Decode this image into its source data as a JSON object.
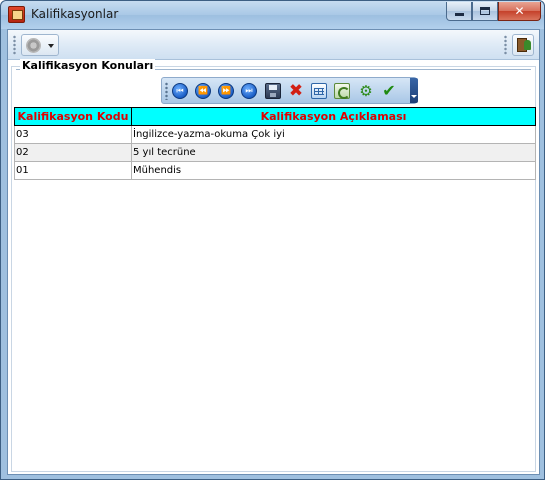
{
  "window": {
    "title": "Kalifikasyonlar",
    "controls": {
      "minimize": "minimize",
      "maximize": "maximize",
      "close": "close"
    }
  },
  "toolbar": {
    "left_tool": "settings-dropdown",
    "right_tool": "exit"
  },
  "group": {
    "title": "Kalifikasyon Konuları"
  },
  "navigator": {
    "buttons": [
      "first",
      "prior",
      "next",
      "last",
      "save",
      "delete",
      "grid",
      "refresh",
      "link",
      "confirm"
    ]
  },
  "table": {
    "columns": [
      "Kalifikasyon Kodu",
      "Kalifikasyon Açıklaması"
    ],
    "rows": [
      {
        "code": "03",
        "description": "İngilizce-yazma-okuma Çok iyi"
      },
      {
        "code": "02",
        "description": "5 yıl tecrüne"
      },
      {
        "code": "01",
        "description": "Mühendis"
      }
    ]
  },
  "colors": {
    "header_bg": "#00ffff",
    "header_text": "#e00000",
    "window_frame": "#9fc0df"
  }
}
